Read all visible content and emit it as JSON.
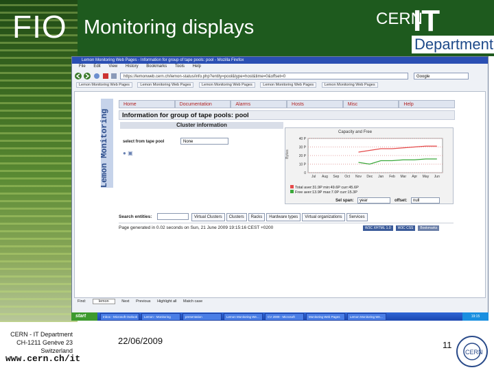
{
  "header": {
    "fio": "FIO",
    "title": "Monitoring displays",
    "cern": "CERN",
    "it": "IT",
    "department": "Department"
  },
  "browser": {
    "window_title": "Lemon Monitoring Web Pages - Information for group of tape pools: pool - Mozilla Firefox",
    "menu": [
      "File",
      "Edit",
      "View",
      "History",
      "Bookmarks",
      "Tools",
      "Help"
    ],
    "url": "https://lemonweb.cern.ch/lemon-status/info.php?entity=pool&type=host&time=0&offset=0",
    "search_engine": "Google",
    "bookmarks": [
      "Lemon Monitoring Web Pages",
      "Lemon Monitoring Web Pages",
      "Lemon Monitoring Web Pages",
      "Lemon Monitoring Web Pages",
      "Lemon Monitoring Web Pages"
    ],
    "find_bar": {
      "label": "Find:",
      "value": "lemon",
      "next": "Next",
      "previous": "Previous",
      "highlight": "Highlight all",
      "match_case": "Match case"
    }
  },
  "lemon": {
    "sidebar_label": "Lemon Monitoring",
    "tabs": [
      "Home",
      "Documentation",
      "Alarms",
      "Hosts",
      "Misc",
      "Help"
    ],
    "info_header": "Information for group of tape pools: pool",
    "cluster_header": "Cluster information",
    "pool_label": "select from tape pool",
    "pool_value": "None",
    "graph": {
      "title": "Capacity and Free",
      "ylabel": "Bytes",
      "legend_total": "Total   aver:31.9P  min:49.6P  curr:45.6P",
      "legend_free": "Free    aver:13.9P  max:7.0P  curr:15.3P",
      "select_span_label": "Sel span:",
      "select_span_value": "year",
      "offset_label": "offset:",
      "offset_value": "null"
    },
    "search_label": "Search entities:",
    "search_categories": [
      "Virtual Clusters",
      "Clusters",
      "Racks",
      "Hardware types",
      "Virtual organizations",
      "Services"
    ],
    "generated": "Page generated in 0.02 seconds on Sun, 21 June 2009 19:15:16 CEST +0200",
    "badges": [
      "W3C XHTML 1.0",
      "W3C CSS",
      "Bookmarks"
    ]
  },
  "chart_data": {
    "type": "line",
    "title": "Capacity and Free",
    "x": [
      "Jul",
      "Aug",
      "Sep",
      "Oct",
      "Nov",
      "Dec",
      "Jan",
      "Feb",
      "Mar",
      "Apr",
      "May",
      "Jun"
    ],
    "ylabel": "Bytes",
    "yticks": [
      "40 P",
      "30 P",
      "20 P",
      "10 P",
      "0"
    ],
    "ylim": [
      0,
      40
    ],
    "series": [
      {
        "name": "Total",
        "values": [
          null,
          null,
          null,
          null,
          24,
          26,
          28,
          28,
          29,
          30,
          31,
          31
        ]
      },
      {
        "name": "Free",
        "values": [
          null,
          null,
          null,
          null,
          12,
          10,
          14,
          14,
          15,
          15,
          16,
          16
        ]
      }
    ],
    "colors": {
      "Total": "#e54a4a",
      "Free": "#3aa83a"
    }
  },
  "taskbar": {
    "start": "start",
    "tasks": [
      "Inbox - Microsoft Outlook",
      "Lemon - Monitoring",
      "presentation",
      "Lemon Monitoring We...",
      "CV 2009 - Microsoft",
      "Monitoring Web Pages",
      "Lemon Monitoring We..."
    ],
    "clock": "19:15"
  },
  "footer": {
    "address": [
      "CERN - IT Department",
      "CH-1211 Genève 23",
      "Switzerland"
    ],
    "www": "www.cern.ch/it",
    "date": "22/06/2009",
    "page": "11"
  }
}
